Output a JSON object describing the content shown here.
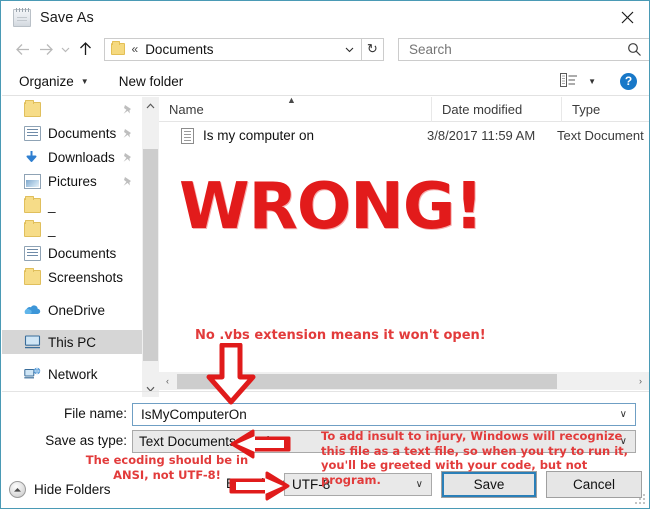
{
  "window": {
    "title": "Save As",
    "icon": "notepad-icon",
    "close_label": "✕"
  },
  "navbar": {
    "back_icon": "arrow-left-icon",
    "forward_icon": "arrow-right-icon",
    "recent_icon": "chevron-down-icon",
    "up_icon": "arrow-up-icon",
    "address": {
      "folder_icon": "folder-icon",
      "chevrons": "«",
      "path": "Documents",
      "dropdown_icon": "chevron-down-icon"
    },
    "refresh_icon": "↻",
    "search": {
      "placeholder": "Search",
      "value": "",
      "icon": "search-icon"
    }
  },
  "toolbar": {
    "organize": "Organize",
    "new_folder": "New folder",
    "view_icon": "view-layout-icon",
    "help_icon": "help-icon",
    "help_glyph": "?"
  },
  "sidebar": {
    "items": [
      {
        "label": "",
        "icon": "folder-icon",
        "pinned": true,
        "selected": false
      },
      {
        "label": "Documents",
        "icon": "documents-icon",
        "pinned": true,
        "selected": false
      },
      {
        "label": "Downloads",
        "icon": "downloads-icon",
        "pinned": true,
        "selected": false
      },
      {
        "label": "Pictures",
        "icon": "pictures-icon",
        "pinned": true,
        "selected": false
      },
      {
        "label": "_",
        "icon": "folder-icon",
        "pinned": false,
        "selected": false
      },
      {
        "label": "_",
        "icon": "folder-icon",
        "pinned": false,
        "selected": false
      },
      {
        "label": "Documents",
        "icon": "documents-icon",
        "pinned": false,
        "selected": false
      },
      {
        "label": "Screenshots",
        "icon": "folder-icon",
        "pinned": false,
        "selected": false
      },
      {
        "label": "OneDrive",
        "icon": "onedrive-icon",
        "pinned": false,
        "selected": false
      },
      {
        "label": "This PC",
        "icon": "this-pc-icon",
        "pinned": false,
        "selected": true
      },
      {
        "label": "Network",
        "icon": "network-icon",
        "pinned": false,
        "selected": false
      }
    ],
    "scroll_up_icon": "chevron-up-icon",
    "scroll_down_icon": "chevron-down-icon"
  },
  "filelist": {
    "columns": [
      "Name",
      "Date modified",
      "Type"
    ],
    "sort_indicator": "chevron-up-icon",
    "rows": [
      {
        "name": "Is my computer on",
        "date_modified": "3/8/2017 11:59 AM",
        "type": "Text Document",
        "icon": "text-document-icon"
      }
    ],
    "hscroll_left_icon": "‹",
    "hscroll_right_icon": "›"
  },
  "form": {
    "filename_label": "File name:",
    "filename_value": "IsMyComputerOn",
    "filename_caret": "∨",
    "savetype_label": "Save as type:",
    "savetype_value": "Text Documents (*.txt)",
    "savetype_caret": "∨",
    "encoding_label": "Encoding:",
    "encoding_value": "UTF-8",
    "encoding_caret": "∨",
    "save_button": "Save",
    "cancel_button": "Cancel",
    "hide_folders": "Hide Folders",
    "hide_folders_icon": "chevron-up-circle-icon"
  },
  "annotations": {
    "wrong": "WRONG!",
    "vbs_note": "No .vbs extension means it won't open!",
    "insult_note": "To add insult to injury, Windows will recognize this file as a text file, so when you try to run it, you'll be greeted with your code, but not program.",
    "ansi_note": "The ecoding should be in ANSI, not UTF-8!",
    "arrow_down_icon": "red-arrow-down-icon",
    "arrow_left_icon": "red-arrow-left-icon",
    "arrow_right_icon": "red-arrow-right-icon"
  },
  "colors": {
    "annotation_red": "#e23b3b",
    "wrong_red": "#e21b1b",
    "frame_blue": "#4a9ab5",
    "focus_blue": "#2a7fb8",
    "help_blue": "#1878c8",
    "selection_gray": "#d6d6d6"
  }
}
